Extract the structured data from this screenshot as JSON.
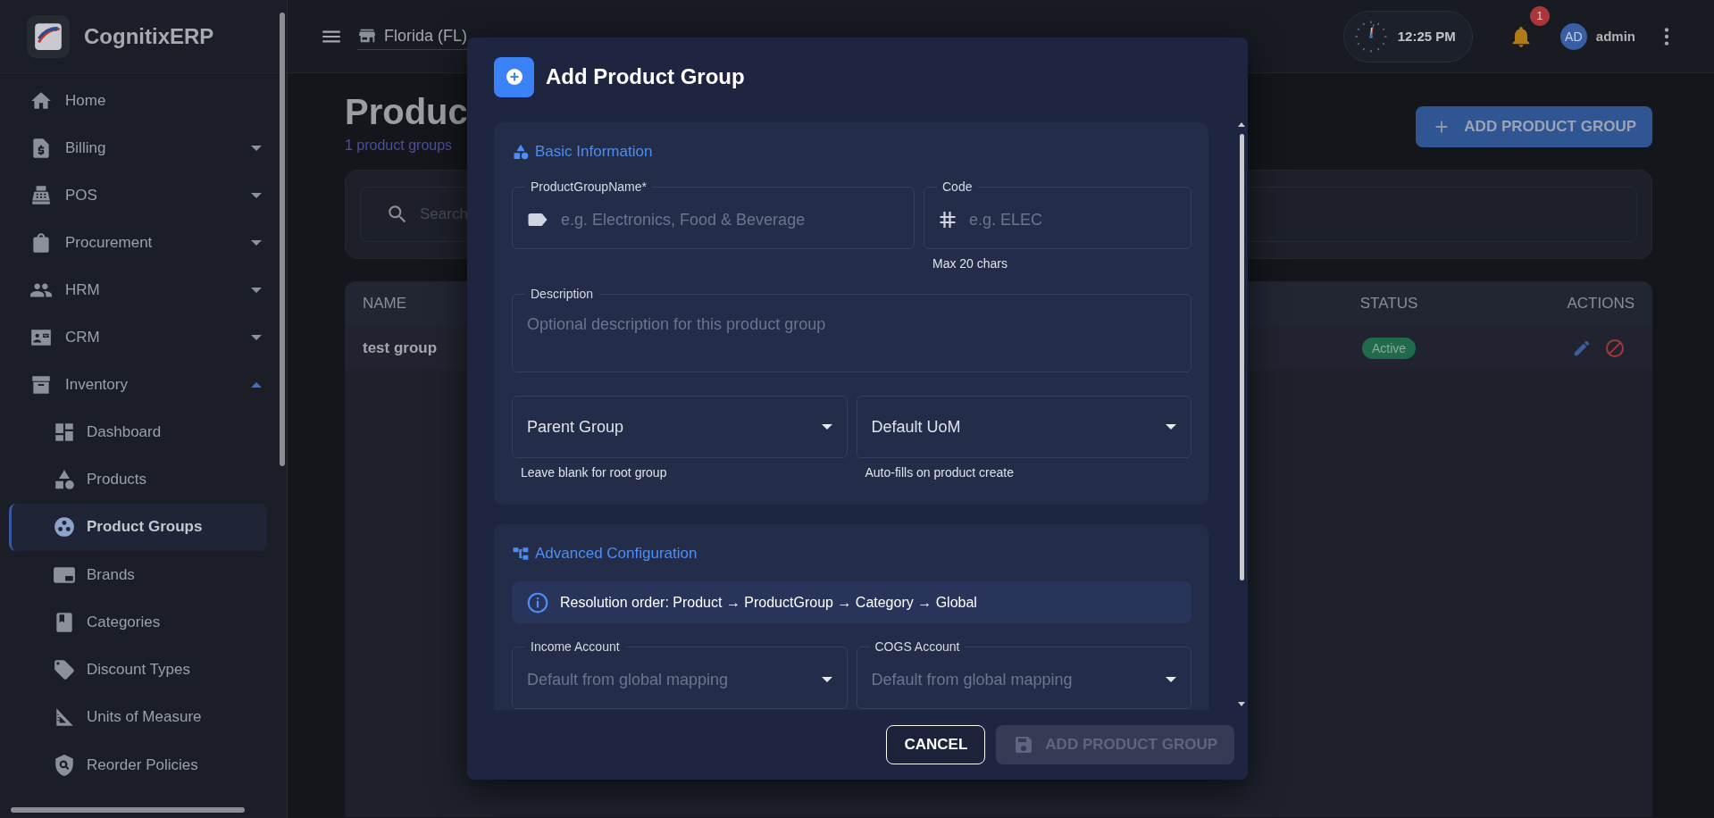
{
  "app": {
    "name": "CognitixERP"
  },
  "sidebar": {
    "items": [
      {
        "label": "Home",
        "kind": "link",
        "selected": false
      },
      {
        "label": "Billing",
        "kind": "group",
        "expanded": false,
        "selected": false
      },
      {
        "label": "POS",
        "kind": "group",
        "expanded": false,
        "selected": false
      },
      {
        "label": "Procurement",
        "kind": "group",
        "expanded": false,
        "selected": false
      },
      {
        "label": "HRM",
        "kind": "group",
        "expanded": false,
        "selected": false
      },
      {
        "label": "CRM",
        "kind": "group",
        "expanded": false,
        "selected": false
      },
      {
        "label": "Inventory",
        "kind": "group",
        "expanded": true,
        "selected": false,
        "children": [
          {
            "label": "Dashboard",
            "selected": false
          },
          {
            "label": "Products",
            "selected": false
          },
          {
            "label": "Product Groups",
            "selected": true
          },
          {
            "label": "Brands",
            "selected": false
          },
          {
            "label": "Categories",
            "selected": false
          },
          {
            "label": "Discount Types",
            "selected": false
          },
          {
            "label": "Units of Measure",
            "selected": false
          },
          {
            "label": "Reorder Policies",
            "selected": false
          }
        ]
      }
    ]
  },
  "topbar": {
    "location": "Florida (FL)",
    "time": "12:25 PM",
    "notifications": "1",
    "avatar": "AD",
    "user": "admin"
  },
  "page": {
    "title": "Produc",
    "subtitle": "1 product groups",
    "add_button": "ADD PRODUCT GROUP",
    "search": {
      "placeholder": "Search"
    },
    "table": {
      "columns": [
        "NAME",
        "STATUS",
        "ACTIONS"
      ],
      "rows": [
        {
          "name": "test group",
          "status": "Active"
        }
      ]
    }
  },
  "dialog": {
    "title": "Add Product Group",
    "sections": [
      {
        "title": "Basic Information",
        "rows": [
          [
            {
              "kind": "text",
              "label": "ProductGroupName*",
              "placeholder": "e.g. Electronics, Food & Beverage"
            },
            {
              "kind": "text",
              "label": "Code",
              "placeholder": "e.g. ELEC",
              "helper": "Max 20 chars"
            }
          ],
          [
            {
              "kind": "textarea",
              "label": "Description",
              "placeholder": "Optional description for this product group"
            }
          ],
          [
            {
              "kind": "select",
              "label": "Parent Group",
              "helper": "Leave blank for root group"
            },
            {
              "kind": "select",
              "label": "Default UoM",
              "helper": "Auto-fills on product create"
            }
          ]
        ]
      },
      {
        "title": "Advanced Configuration",
        "info": "Resolution order: Product → ProductGroup → Category → Global",
        "rows": [
          [
            {
              "kind": "select",
              "label": "Income Account",
              "placeholder": "Default from global mapping"
            },
            {
              "kind": "select",
              "label": "COGS Account",
              "placeholder": "Default from global mapping"
            }
          ]
        ]
      }
    ],
    "buttons": [
      {
        "label": "CANCEL",
        "kind": "outlined",
        "disabled": false
      },
      {
        "label": "ADD PRODUCT GROUP",
        "kind": "contained",
        "disabled": true
      }
    ]
  }
}
